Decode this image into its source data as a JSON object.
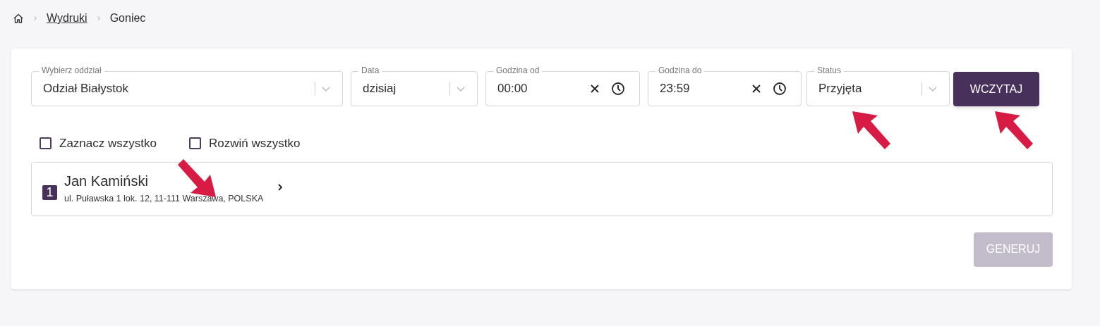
{
  "breadcrumb": [
    {
      "label": "Wydruki",
      "kind": "link"
    },
    {
      "label": "Goniec",
      "kind": "current"
    }
  ],
  "filters": [
    {
      "kind": "select",
      "label": "Wybierz oddział",
      "value": "Odział Białystok"
    },
    {
      "kind": "select",
      "label": "Data",
      "value": "dzisiaj"
    },
    {
      "kind": "time",
      "label": "Godzina od",
      "value": "00:00"
    },
    {
      "kind": "time",
      "label": "Godzina do",
      "value": "23:59"
    },
    {
      "kind": "select",
      "label": "Status",
      "value": "Przyjęta"
    }
  ],
  "load_button": {
    "label": "WCZYTAJ",
    "disabled": false
  },
  "options": [
    {
      "label": "Zaznacz wszystko",
      "checked": false
    },
    {
      "label": "Rozwiń wszystko",
      "checked": false
    }
  ],
  "recipients": [
    {
      "number": "1",
      "name": "Jan Kamiński",
      "address": "ul. Puławska 1 lok. 12, 11-111 Warszawa, POLSKA",
      "expanded": false
    }
  ],
  "generate_button": {
    "label": "GENERUJ",
    "disabled": true
  }
}
